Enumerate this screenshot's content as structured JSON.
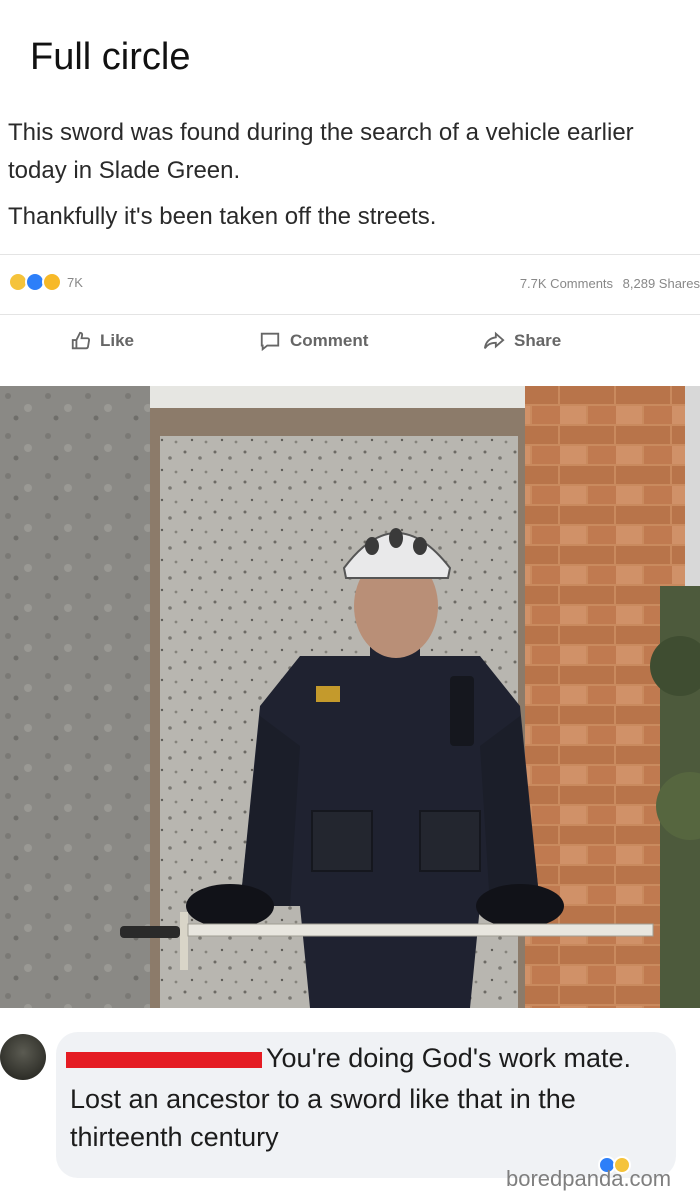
{
  "meme": {
    "title": "Full circle"
  },
  "post": {
    "text_line1": "This sword was found during the search of a vehicle earlier today in Slade Green.",
    "text_line2": "Thankfully it's been taken off the streets.",
    "reaction_icons": [
      "haha-icon",
      "like-icon",
      "wow-icon"
    ],
    "reaction_count": "7K",
    "comments_count": "7.7K Comments",
    "shares_count": "8,289 Shares",
    "actions": {
      "like": "Like",
      "comment": "Comment",
      "share": "Share"
    }
  },
  "comment": {
    "line1": "You're doing God's work mate.",
    "line2": "Lost an ancestor to a sword like that in the",
    "line3": "thirteenth century"
  },
  "watermark": "boredpanda.com",
  "colors": {
    "redaction": "#e51c23",
    "like_blue": "#2d7ff9",
    "haha_yellow": "#f5c33b",
    "comment_bubble": "#f0f2f5"
  }
}
